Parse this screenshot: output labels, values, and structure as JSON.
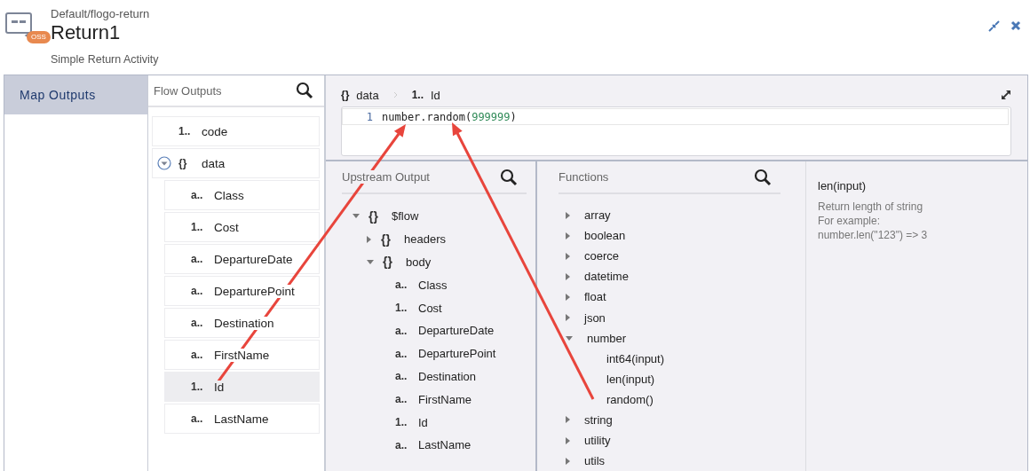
{
  "header": {
    "breadcrumb": "Default/flogo-return",
    "title": "Return1",
    "badge": "OSS",
    "subtitle": "Simple Return Activity"
  },
  "nav": [
    {
      "label": "Map Outputs",
      "selected": true
    }
  ],
  "flow_outputs": {
    "title": "Flow Outputs",
    "items": [
      {
        "type": "1..",
        "name": "code",
        "selected": false
      },
      {
        "type": "{}",
        "name": "data",
        "selected": false,
        "expanded": true,
        "children": [
          {
            "type": "a..",
            "name": "Class",
            "selected": false
          },
          {
            "type": "1..",
            "name": "Cost",
            "selected": false
          },
          {
            "type": "a..",
            "name": "DepartureDate",
            "selected": false
          },
          {
            "type": "a..",
            "name": "DeparturePoint",
            "selected": false
          },
          {
            "type": "a..",
            "name": "Destination",
            "selected": false
          },
          {
            "type": "a..",
            "name": "FirstName",
            "selected": false
          },
          {
            "type": "1..",
            "name": "Id",
            "selected": true
          },
          {
            "type": "a..",
            "name": "LastName",
            "selected": false
          }
        ]
      }
    ]
  },
  "editor": {
    "path": [
      {
        "type": "{}",
        "name": "data"
      },
      {
        "type": "1..",
        "name": "Id"
      }
    ],
    "lines": [
      {
        "number": "1",
        "tokens": [
          {
            "text": "number.random(",
            "kind": "plain"
          },
          {
            "text": "999999",
            "kind": "number"
          },
          {
            "text": ")",
            "kind": "plain"
          }
        ]
      }
    ]
  },
  "upstream": {
    "title": "Upstream Output",
    "tree": [
      {
        "type": "{}",
        "name": "$flow",
        "expanded": true,
        "children": [
          {
            "type": "{}",
            "name": "headers",
            "expanded": false
          },
          {
            "type": "{}",
            "name": "body",
            "expanded": true,
            "children": [
              {
                "type": "a..",
                "name": "Class"
              },
              {
                "type": "1..",
                "name": "Cost"
              },
              {
                "type": "a..",
                "name": "DepartureDate"
              },
              {
                "type": "a..",
                "name": "DeparturePoint"
              },
              {
                "type": "a..",
                "name": "Destination"
              },
              {
                "type": "a..",
                "name": "FirstName"
              },
              {
                "type": "1..",
                "name": "Id"
              },
              {
                "type": "a..",
                "name": "LastName"
              }
            ]
          }
        ]
      }
    ]
  },
  "functions": {
    "title": "Functions",
    "groups": [
      {
        "name": "array",
        "expanded": false
      },
      {
        "name": "boolean",
        "expanded": false
      },
      {
        "name": "coerce",
        "expanded": false
      },
      {
        "name": "datetime",
        "expanded": false
      },
      {
        "name": "float",
        "expanded": false
      },
      {
        "name": "json",
        "expanded": false
      },
      {
        "name": "number",
        "expanded": true,
        "children": [
          {
            "name": "int64(input)"
          },
          {
            "name": "len(input)"
          },
          {
            "name": "random()"
          }
        ]
      },
      {
        "name": "string",
        "expanded": false
      },
      {
        "name": "utility",
        "expanded": false
      },
      {
        "name": "utils",
        "expanded": false
      }
    ]
  },
  "details": {
    "title": "len(input)",
    "lines": [
      "Return length of string",
      "For example:",
      "number.len(\"123\") => 3"
    ]
  }
}
